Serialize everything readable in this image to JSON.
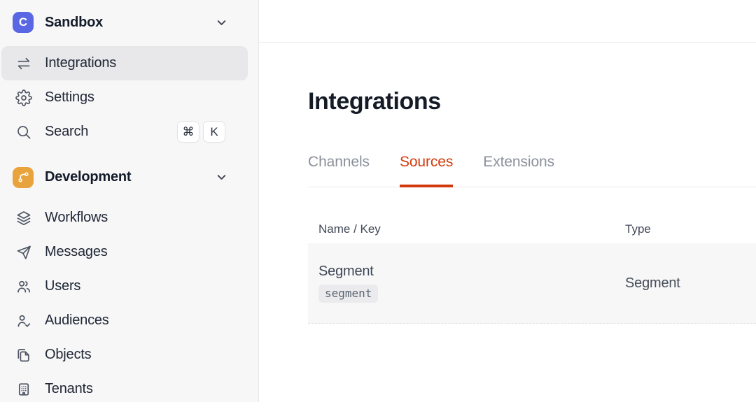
{
  "colors": {
    "accent": "#D23A0C",
    "logo_indigo": "#5A67E5",
    "dev_orange": "#E8A33D",
    "selected_bg": "#E8E8EA",
    "sidebar_bg": "#F7F7F8"
  },
  "workspace": {
    "name": "Sandbox",
    "logo_letter": "C"
  },
  "sidebar": {
    "items_top": [
      {
        "label": "Integrations",
        "icon": "swap-arrows-icon",
        "active": true
      },
      {
        "label": "Settings",
        "icon": "gear-icon",
        "active": false
      },
      {
        "label": "Search",
        "icon": "search-icon",
        "active": false,
        "shortcut_keys": [
          "⌘",
          "K"
        ]
      }
    ],
    "section": {
      "label": "Development",
      "icon": "git-branch-icon"
    },
    "items_dev": [
      {
        "label": "Workflows",
        "icon": "layers-icon"
      },
      {
        "label": "Messages",
        "icon": "paper-plane-icon"
      },
      {
        "label": "Users",
        "icon": "users-icon"
      },
      {
        "label": "Audiences",
        "icon": "user-check-icon"
      },
      {
        "label": "Objects",
        "icon": "copy-pages-icon"
      },
      {
        "label": "Tenants",
        "icon": "building-icon"
      }
    ]
  },
  "main": {
    "title": "Integrations",
    "tabs": [
      {
        "label": "Channels",
        "active": false
      },
      {
        "label": "Sources",
        "active": true
      },
      {
        "label": "Extensions",
        "active": false
      }
    ],
    "table": {
      "columns": [
        "Name / Key",
        "Type"
      ],
      "rows": [
        {
          "name": "Segment",
          "key": "segment",
          "type": "Segment"
        }
      ]
    }
  }
}
